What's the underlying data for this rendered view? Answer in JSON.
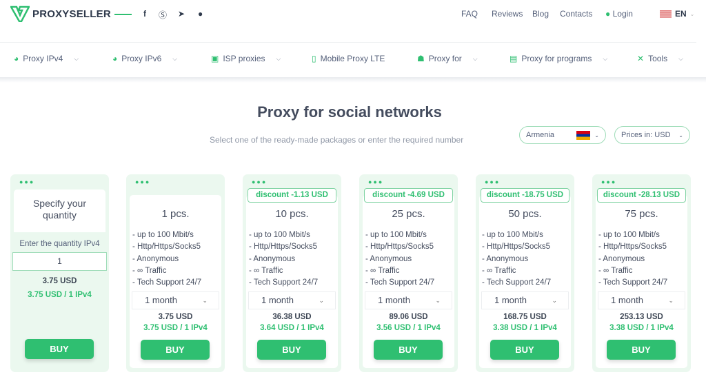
{
  "header": {
    "brand": "PROXYSELLER",
    "nav": [
      "FAQ",
      "Reviews",
      "Blog",
      "Contacts"
    ],
    "login": "Login",
    "lang": "EN",
    "social_icons": [
      "facebook-icon",
      "skype-icon",
      "telegram-icon",
      "chat-icon"
    ]
  },
  "menu": [
    {
      "label": "Proxy IPv4"
    },
    {
      "label": "Proxy IPv6"
    },
    {
      "label": "ISP proxies"
    },
    {
      "label": "Mobile Proxy LTE"
    },
    {
      "label": "Proxy for"
    },
    {
      "label": "Proxy for programs"
    },
    {
      "label": "Tools"
    }
  ],
  "page": {
    "title": "Proxy for social networks",
    "subtitle": "Select one of the ready-made packages or enter the required number",
    "country": "Armenia",
    "currency": "Prices in: USD"
  },
  "custom": {
    "title_1": "Specify your",
    "title_2": "quantity",
    "label": "Enter the quantity IPv4",
    "value": "1",
    "price": "3.75 USD",
    "per": "3.75 USD / 1 IPv4",
    "buy": "BUY"
  },
  "features": [
    "- up to 100 Mbit/s",
    "- Http/Https/Socks5",
    "- Anonymous",
    "- ∞ Traffic",
    "- Tech Support 24/7"
  ],
  "packages": [
    {
      "discount": "",
      "qty": "1 pcs.",
      "period": "1 month",
      "price": "3.75 USD",
      "per": "3.75 USD / 1 IPv4",
      "buy": "BUY"
    },
    {
      "discount": "discount -1.13 USD",
      "qty": "10 pcs.",
      "period": "1 month",
      "price": "36.38 USD",
      "per": "3.64 USD / 1 IPv4",
      "buy": "BUY"
    },
    {
      "discount": "discount -4.69 USD",
      "qty": "25 pcs.",
      "period": "1 month",
      "price": "89.06 USD",
      "per": "3.56 USD / 1 IPv4",
      "buy": "BUY"
    },
    {
      "discount": "discount -18.75 USD",
      "qty": "50 pcs.",
      "period": "1 month",
      "price": "168.75 USD",
      "per": "3.38 USD / 1 IPv4",
      "buy": "BUY"
    },
    {
      "discount": "discount -28.13 USD",
      "qty": "75 pcs.",
      "period": "1 month",
      "price": "253.13 USD",
      "per": "3.38 USD / 1 IPv4",
      "buy": "BUY"
    }
  ],
  "colors": {
    "accent": "#2fbf71",
    "card_bg": "#ebf8ef",
    "text": "#3d4654"
  }
}
